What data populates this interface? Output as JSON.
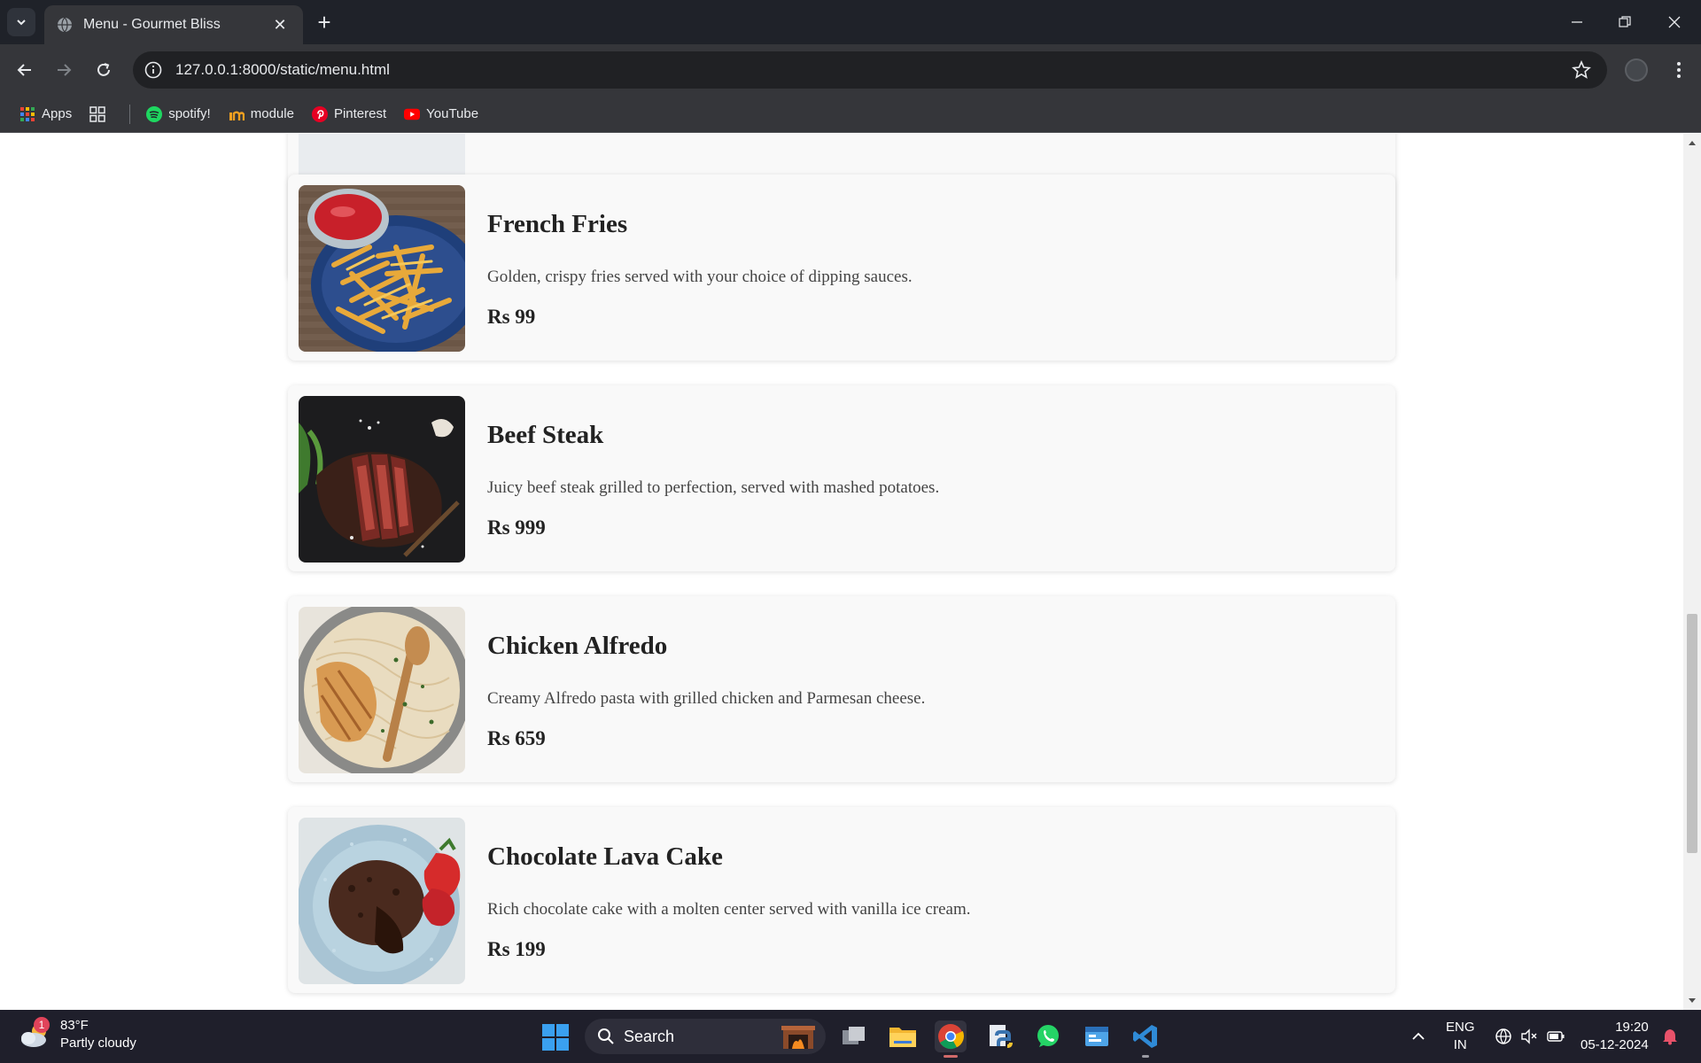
{
  "browser": {
    "tab_title": "Menu - Gourmet Bliss",
    "url": "127.0.0.1:8000/static/menu.html",
    "bookmarks": [
      {
        "label": "Apps",
        "icon": "apps-grid-icon"
      },
      {
        "label": "",
        "icon": "tab-groups-icon"
      },
      {
        "label": "spotify!",
        "icon": "spotify-icon"
      },
      {
        "label": "module",
        "icon": "module-icon"
      },
      {
        "label": "Pinterest",
        "icon": "pinterest-icon"
      },
      {
        "label": "YouTube",
        "icon": "youtube-icon"
      }
    ]
  },
  "menu": {
    "items": [
      {
        "name": "French Fries",
        "description": "Golden, crispy fries served with your choice of dipping sauces.",
        "price": "Rs 99",
        "image": "french-fries-image"
      },
      {
        "name": "Beef Steak",
        "description": "Juicy beef steak grilled to perfection, served with mashed potatoes.",
        "price": "Rs 999",
        "image": "beef-steak-image"
      },
      {
        "name": "Chicken Alfredo",
        "description": "Creamy Alfredo pasta with grilled chicken and Parmesan cheese.",
        "price": "Rs 659",
        "image": "chicken-alfredo-image"
      },
      {
        "name": "Chocolate Lava Cake",
        "description": "Rich chocolate cake with a molten center served with vanilla ice cream.",
        "price": "Rs 199",
        "image": "chocolate-lava-cake-image"
      }
    ]
  },
  "taskbar": {
    "weather_temp": "83°F",
    "weather_desc": "Partly cloudy",
    "weather_badge": "1",
    "search_label": "Search",
    "lang_top": "ENG",
    "lang_bottom": "IN",
    "time": "19:20",
    "date": "05-12-2024"
  },
  "colors": {
    "tabbar": "#1f2229",
    "toolbar": "#35363a",
    "card_bg": "#f9f9f9",
    "taskbar": "#1f1f2b"
  }
}
